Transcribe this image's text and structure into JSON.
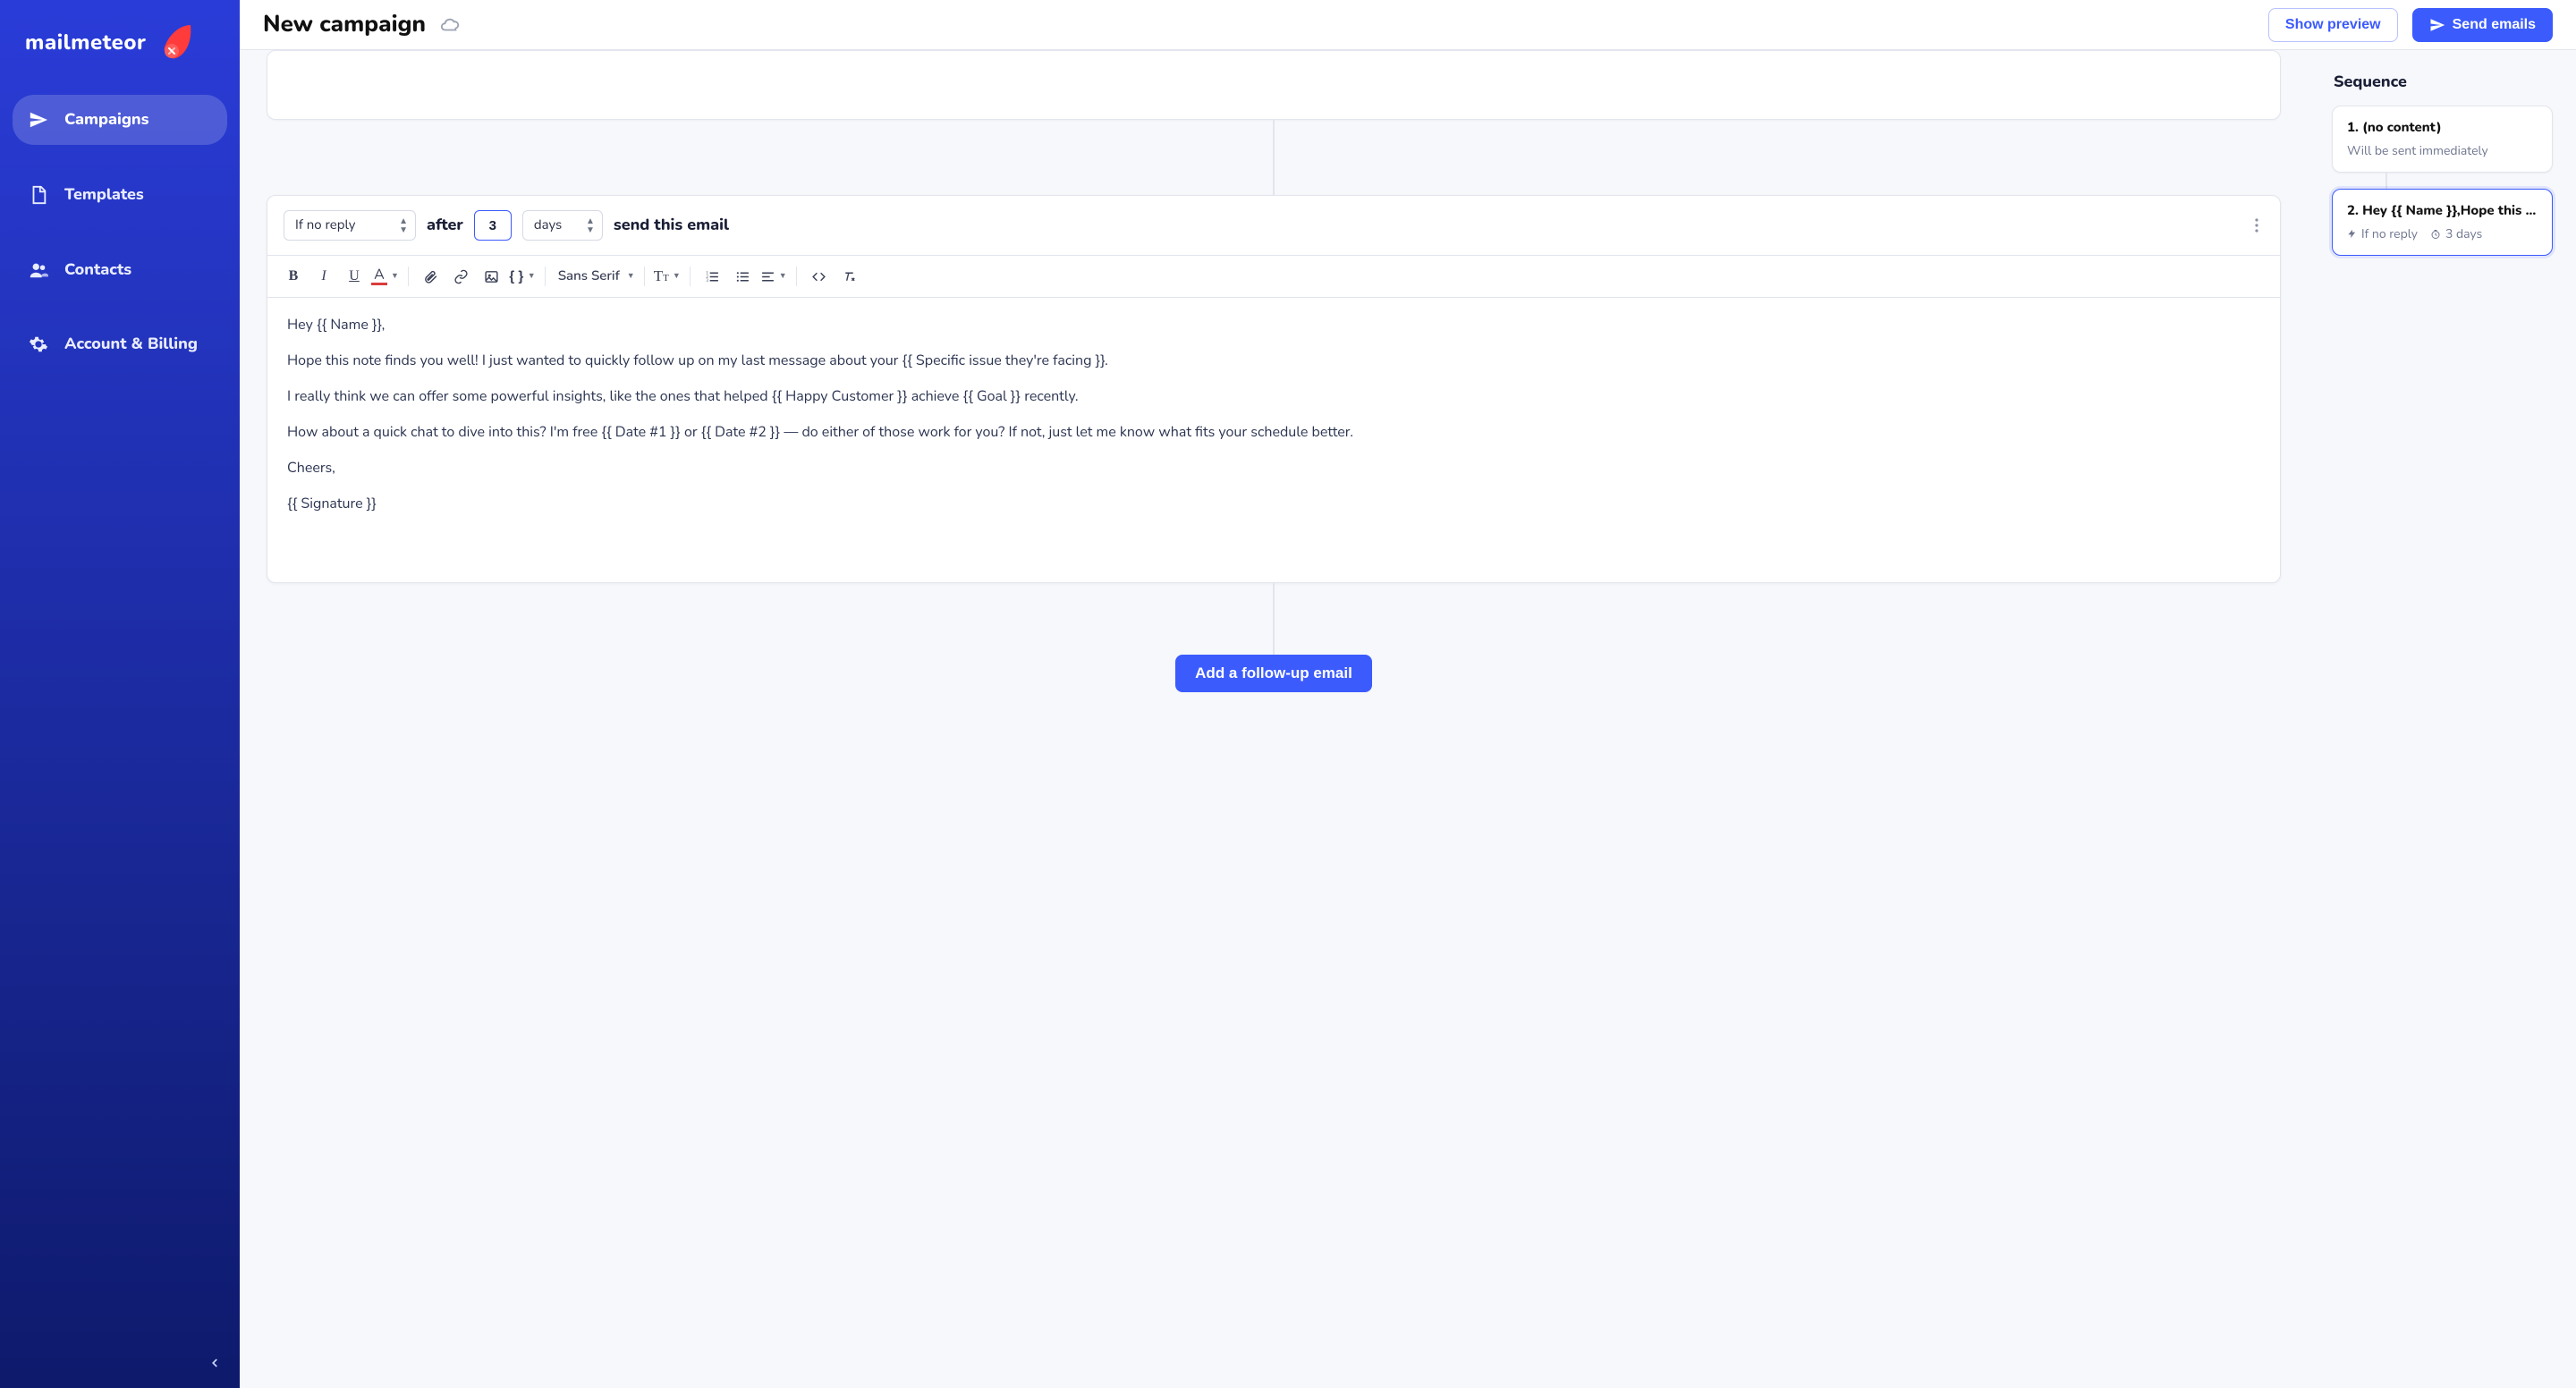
{
  "brand": "mailmeteor",
  "sidebar": {
    "items": [
      {
        "label": "Campaigns"
      },
      {
        "label": "Templates"
      },
      {
        "label": "Contacts"
      },
      {
        "label": "Account & Billing"
      }
    ]
  },
  "header": {
    "title": "New campaign",
    "preview_btn": "Show preview",
    "send_btn": "Send emails"
  },
  "condition": {
    "trigger": "If no reply",
    "after_label": "after",
    "count": "3",
    "unit": "days",
    "suffix": "send this email"
  },
  "toolbar": {
    "font": "Sans Serif"
  },
  "email_body": {
    "p1": "Hey {{ Name }},",
    "p2": "Hope this note finds you well! I just wanted to quickly follow up on my last message about your {{ Specific issue they're facing }}.",
    "p3": "I really think we can offer some powerful insights, like the ones that helped {{ Happy Customer }} achieve {{ Goal }} recently.",
    "p4": "How about a quick chat to dive into this? I'm free {{ Date #1 }} or {{ Date #2 }} — do either of those work for you? If not, just let me know what fits your schedule better.",
    "p5": "Cheers,",
    "p6": "{{ Signature }}"
  },
  "add_followup": "Add a follow-up email",
  "sequence": {
    "title": "Sequence",
    "steps": [
      {
        "title": "1. (no content)",
        "meta1": "Will be sent immediately"
      },
      {
        "title": "2. Hey {{ Name }},Hope this ...",
        "cond": "If no reply",
        "delay": "3 days"
      }
    ]
  }
}
